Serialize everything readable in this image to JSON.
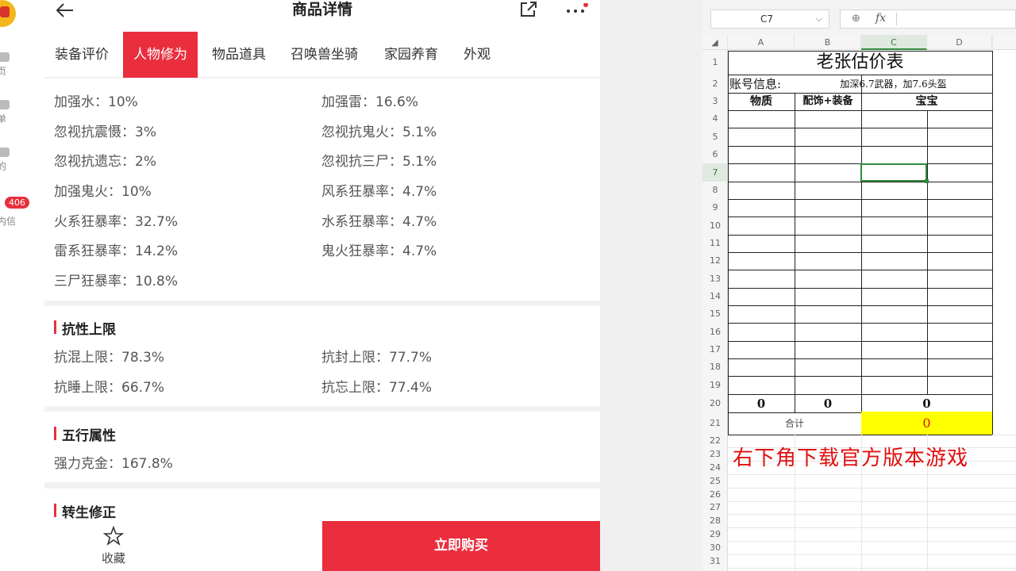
{
  "sidebar": {
    "items": [
      {
        "label": "首页",
        "icon": "home-icon"
      },
      {
        "label": "订单",
        "icon": "order-icon"
      },
      {
        "label": "我的",
        "icon": "user-icon"
      },
      {
        "label": "站内信",
        "icon": "message-icon",
        "badge": "406"
      }
    ],
    "visible_labels": [
      "页",
      "单",
      "的",
      "内信"
    ]
  },
  "header": {
    "title": "商品详情"
  },
  "tabs": [
    {
      "label": "装备评价",
      "active": false
    },
    {
      "label": "人物修为",
      "active": true
    },
    {
      "label": "物品道具",
      "active": false
    },
    {
      "label": "召唤兽坐骑",
      "active": false
    },
    {
      "label": "家园养育",
      "active": false
    },
    {
      "label": "外观",
      "active": false
    }
  ],
  "stats": {
    "left": [
      "加强水：10%",
      "忽视抗震慑：3%",
      "忽视抗遗忘：2%",
      "加强鬼火：10%",
      "火系狂暴率：32.7%",
      "雷系狂暴率：14.2%",
      "三尸狂暴率：10.8%"
    ],
    "right": [
      "加强雷：16.6%",
      "忽视抗鬼火：5.1%",
      "忽视抗三尸：5.1%",
      "风系狂暴率：4.7%",
      "水系狂暴率：4.7%",
      "鬼火狂暴率：4.7%"
    ]
  },
  "resist": {
    "title": "抗性上限",
    "left": [
      "抗混上限：78.3%",
      "抗睡上限：66.7%"
    ],
    "right": [
      "抗封上限：77.7%",
      "抗忘上限：77.4%"
    ]
  },
  "wuxing": {
    "title": "五行属性",
    "items": [
      "强力克金：167.8%"
    ]
  },
  "rebirth": {
    "title": "转生修正"
  },
  "bottom": {
    "fav_label": "收藏",
    "buy_label": "立即购买"
  },
  "colors": {
    "accent": "#ea2e3e",
    "sheet_select": "#2e8b3a",
    "highlight": "#ffff00",
    "promo": "#e01010"
  },
  "spreadsheet": {
    "name_box": "C7",
    "fx": "fx",
    "columns": [
      "A",
      "B",
      "C",
      "D"
    ],
    "active_column": "C",
    "active_row": "7",
    "rows": [
      "1",
      "2",
      "3",
      "4",
      "5",
      "6",
      "7",
      "8",
      "9",
      "10",
      "11",
      "12",
      "13",
      "14",
      "15",
      "16",
      "17",
      "18",
      "19",
      "20",
      "21",
      "22",
      "23",
      "24",
      "25",
      "26",
      "27",
      "28",
      "29",
      "30",
      "31"
    ],
    "title": "老张估价表",
    "account_label": "账号信息:",
    "account_value": "加深6.7武器，加7.6头盔",
    "headers": [
      "物质",
      "配饰+装备",
      "宝宝"
    ],
    "row20": [
      "0",
      "0",
      "0"
    ],
    "total_label": "合计",
    "total_value": "0",
    "promo": "右下角下载官方版本游戏"
  }
}
